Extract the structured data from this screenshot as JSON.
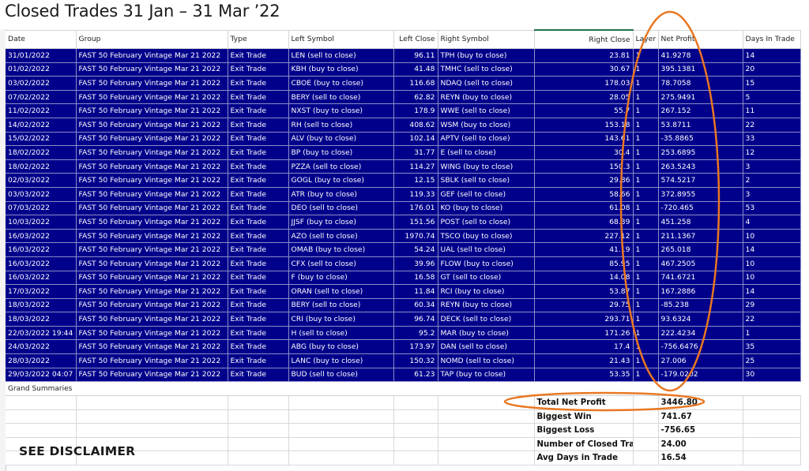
{
  "title": "Closed Trades 31 Jan – 31 Mar ’22",
  "columns": [
    "Date",
    "Group",
    "Type",
    "Left Symbol",
    "Left Close",
    "Right Symbol",
    "Right Close",
    "Layer",
    "Net Profit",
    "Days In Trade"
  ],
  "rows": [
    [
      "31/01/2022",
      "FAST 50 February Vintage  Mar 21 2022",
      "Exit Trade",
      "LEN  (sell to close)",
      "96.11",
      "TPH  (buy to close)",
      "23.81",
      "1",
      "41.9278",
      "14"
    ],
    [
      "01/02/2022",
      "FAST 50 February Vintage  Mar 21 2022",
      "Exit Trade",
      "KBH  (buy to close)",
      "41.48",
      "TMHC  (sell to close)",
      "30.67",
      "1",
      "395.1381",
      "20"
    ],
    [
      "03/02/2022",
      "FAST 50 February Vintage  Mar 21 2022",
      "Exit Trade",
      "CBOE  (buy to close)",
      "116.68",
      "NDAQ  (sell to close)",
      "178.03",
      "1",
      "78.7058",
      "15"
    ],
    [
      "07/02/2022",
      "FAST 50 February Vintage  Mar 21 2022",
      "Exit Trade",
      "BERY  (sell to close)",
      "62.82",
      "REYN  (buy to close)",
      "28.05",
      "1",
      "275.9491",
      "5"
    ],
    [
      "11/02/2022",
      "FAST 50 February Vintage  Mar 21 2022",
      "Exit Trade",
      "NXST  (buy to close)",
      "178.9",
      "WWE  (sell to close)",
      "55.7",
      "1",
      "267.152",
      "11"
    ],
    [
      "14/02/2022",
      "FAST 50 February Vintage  Mar 21 2022",
      "Exit Trade",
      "RH  (sell to close)",
      "408.62",
      "WSM  (buy to close)",
      "153.18",
      "1",
      "53.8711",
      "22"
    ],
    [
      "15/02/2022",
      "FAST 50 February Vintage  Mar 21 2022",
      "Exit Trade",
      "ALV  (buy to close)",
      "102.14",
      "APTV  (sell to close)",
      "143.61",
      "1",
      "-35.8865",
      "33"
    ],
    [
      "18/02/2022",
      "FAST 50 February Vintage  Mar 21 2022",
      "Exit Trade",
      "BP  (buy to close)",
      "31.77",
      "E  (sell to close)",
      "30.4",
      "1",
      "253.6895",
      "12"
    ],
    [
      "18/02/2022",
      "FAST 50 February Vintage  Mar 21 2022",
      "Exit Trade",
      "PZZA  (sell to close)",
      "114.27",
      "WING  (buy to close)",
      "150.3",
      "1",
      "263.5243",
      "3"
    ],
    [
      "02/03/2022",
      "FAST 50 February Vintage  Mar 21 2022",
      "Exit Trade",
      "GOGL  (buy to close)",
      "12.15",
      "SBLK  (sell to close)",
      "29.86",
      "1",
      "574.5217",
      "2"
    ],
    [
      "03/03/2022",
      "FAST 50 February Vintage  Mar 21 2022",
      "Exit Trade",
      "ATR  (buy to close)",
      "119.33",
      "GEF  (sell to close)",
      "58.66",
      "1",
      "372.8955",
      "3"
    ],
    [
      "07/03/2022",
      "FAST 50 February Vintage  Mar 21 2022",
      "Exit Trade",
      "DEO  (sell to close)",
      "176.01",
      "KO  (buy to close)",
      "61.08",
      "1",
      "-720.465",
      "53"
    ],
    [
      "10/03/2022",
      "FAST 50 February Vintage  Mar 21 2022",
      "Exit Trade",
      "JJSF  (buy to close)",
      "151.56",
      "POST  (sell to close)",
      "68.39",
      "1",
      "451.258",
      "4"
    ],
    [
      "16/03/2022",
      "FAST 50 February Vintage  Mar 21 2022",
      "Exit Trade",
      "AZO  (sell to close)",
      "1970.74",
      "TSCO  (buy to close)",
      "227.12",
      "1",
      "211.1367",
      "10"
    ],
    [
      "16/03/2022",
      "FAST 50 February Vintage  Mar 21 2022",
      "Exit Trade",
      "OMAB  (buy to close)",
      "54.24",
      "UAL  (sell to close)",
      "41.19",
      "1",
      "265.018",
      "14"
    ],
    [
      "16/03/2022",
      "FAST 50 February Vintage  Mar 21 2022",
      "Exit Trade",
      "CFX  (sell to close)",
      "39.96",
      "FLOW  (buy to close)",
      "85.95",
      "1",
      "467.2505",
      "10"
    ],
    [
      "16/03/2022",
      "FAST 50 February Vintage  Mar 21 2022",
      "Exit Trade",
      "F  (buy to close)",
      "16.58",
      "GT  (sell to close)",
      "14.08",
      "1",
      "741.6721",
      "10"
    ],
    [
      "17/03/2022",
      "FAST 50 February Vintage  Mar 21 2022",
      "Exit Trade",
      "ORAN  (sell to close)",
      "11.84",
      "RCI  (buy to close)",
      "53.87",
      "1",
      "167.2886",
      "14"
    ],
    [
      "18/03/2022",
      "FAST 50 February Vintage  Mar 21 2022",
      "Exit Trade",
      "BERY  (sell to close)",
      "60.34",
      "REYN  (buy to close)",
      "29.75",
      "1",
      "-85.238",
      "29"
    ],
    [
      "18/03/2022",
      "FAST 50 February Vintage  Mar 21 2022",
      "Exit Trade",
      "CRI  (buy to close)",
      "96.74",
      "DECK  (sell to close)",
      "293.71",
      "1",
      "93.6324",
      "22"
    ],
    [
      "22/03/2022 19:44",
      "FAST 50 February Vintage  Mar 21 2022",
      "Exit Trade",
      "H  (sell to close)",
      "95.2",
      "MAR  (buy to close)",
      "171.26",
      "1",
      "222.4234",
      "1"
    ],
    [
      "24/03/2022",
      "FAST 50 February Vintage  Mar 21 2022",
      "Exit Trade",
      "ABG  (buy to close)",
      "173.97",
      "DAN  (sell to close)",
      "17.4",
      "1",
      "-756.6476",
      "35"
    ],
    [
      "28/03/2022",
      "FAST 50 February Vintage  Mar 21 2022",
      "Exit Trade",
      "LANC  (buy to close)",
      "150.32",
      "NOMD  (sell to close)",
      "21.43",
      "1",
      "27.006",
      "25"
    ],
    [
      "29/03/2022 04:07",
      "FAST 50 February Vintage  Mar 21 2022",
      "Exit Trade",
      "BUD  (sell to close)",
      "61.23",
      "TAP  (buy to close)",
      "53.35",
      "1",
      "-179.0202",
      "30"
    ]
  ],
  "grand_summaries_label": "Grand Summaries",
  "summary": [
    {
      "label": "Total Net Profit",
      "value": "3446.80"
    },
    {
      "label": "Biggest Win",
      "value": "741.67"
    },
    {
      "label": "Biggest Loss",
      "value": "-756.65"
    },
    {
      "label": "Number of Closed Trades",
      "value": "24.00"
    },
    {
      "label": "Avg Days in Trade",
      "value": "16.54"
    }
  ],
  "disclaimer": "SEE DISCLAIMER",
  "colors": {
    "row_highlight": "#00008b",
    "annotation": "#e87722"
  }
}
